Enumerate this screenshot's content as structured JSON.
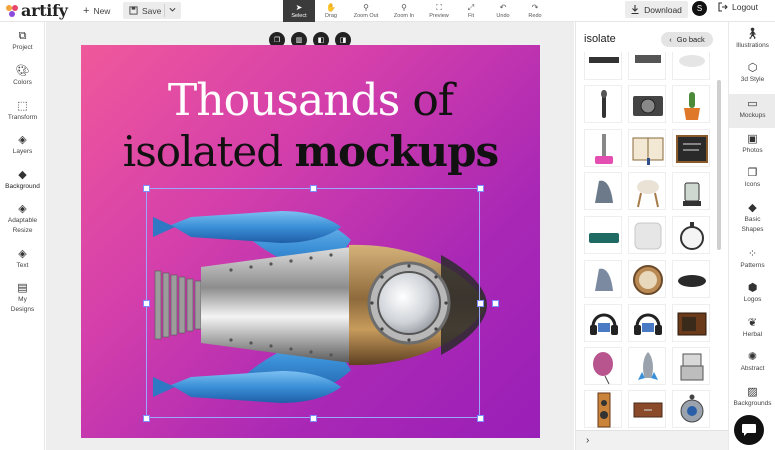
{
  "brand": {
    "name": "artify"
  },
  "toolbar": {
    "new_label": "New",
    "save_label": "Save",
    "tools": [
      {
        "label": "Select",
        "icon": "cursor-icon",
        "active": true
      },
      {
        "label": "Drag",
        "icon": "hand-icon"
      },
      {
        "label": "Zoom Out",
        "icon": "zoom-out-icon"
      },
      {
        "label": "Zoom In",
        "icon": "zoom-in-icon"
      },
      {
        "label": "Preview",
        "icon": "preview-icon"
      },
      {
        "label": "Fit",
        "icon": "fit-icon"
      },
      {
        "label": "Undo",
        "icon": "undo-icon"
      },
      {
        "label": "Redo",
        "icon": "redo-icon"
      }
    ],
    "download_label": "Download",
    "avatar_initial": "S",
    "logout_label": "Logout"
  },
  "left_sidebar": {
    "items": [
      {
        "label": "Project",
        "icon": "project-icon"
      },
      {
        "label": "Colors",
        "icon": "palette-icon"
      },
      {
        "label": "Transform",
        "icon": "transform-icon"
      },
      {
        "label": "Layers",
        "icon": "layers-icon"
      },
      {
        "label": "Background",
        "icon": "paint-bucket-icon",
        "active": true
      },
      {
        "label_line1": "Adaptable",
        "label_line2": "Resize",
        "icon": "stack-icon"
      },
      {
        "label": "Text",
        "icon": "text-icon"
      },
      {
        "label_line1": "My",
        "label_line2": "Designs",
        "icon": "folder-icon"
      }
    ]
  },
  "context_menu": {
    "items": [
      {
        "label": "Clone",
        "icon": "clone-icon"
      },
      {
        "label": "Del",
        "icon": "trash-icon"
      },
      {
        "label": "Fwd",
        "icon": "bring-forward-icon"
      },
      {
        "label": "Bwd",
        "icon": "send-backward-icon"
      }
    ]
  },
  "canvas": {
    "line1_a": "Thousands",
    "line1_b": "of",
    "line2_a": "isolated",
    "line2_b": "mockups",
    "gradient_start": "#f0589b",
    "gradient_end": "#9a1fb8"
  },
  "right_panel": {
    "search_term": "isolate",
    "go_back_label": "Go back",
    "thumbnails": [
      {
        "icon": "device-edge-icon"
      },
      {
        "icon": "camera-edge-icon"
      },
      {
        "icon": "cloud-icon"
      },
      {
        "icon": "microphone-icon"
      },
      {
        "icon": "camera-icon"
      },
      {
        "icon": "cactus-icon"
      },
      {
        "icon": "pink-stand-icon"
      },
      {
        "icon": "open-book-icon"
      },
      {
        "icon": "chalkboard-icon"
      },
      {
        "icon": "iron-icon"
      },
      {
        "icon": "chair-icon"
      },
      {
        "icon": "lantern-icon"
      },
      {
        "icon": "sofa-icon"
      },
      {
        "icon": "pillow-icon"
      },
      {
        "icon": "stopwatch-icon"
      },
      {
        "icon": "iron-icon"
      },
      {
        "icon": "clock-icon"
      },
      {
        "icon": "tray-icon"
      },
      {
        "icon": "headphones-icon"
      },
      {
        "icon": "headphones-icon"
      },
      {
        "icon": "radio-icon"
      },
      {
        "icon": "balloon-icon"
      },
      {
        "icon": "rocket-icon"
      },
      {
        "icon": "robot-icon"
      },
      {
        "icon": "speaker-icon"
      },
      {
        "icon": "drawer-icon"
      },
      {
        "icon": "robot-ball-icon"
      },
      {
        "icon": "partial-icon"
      },
      {
        "icon": "partial-icon"
      },
      {
        "icon": "partial-icon"
      }
    ]
  },
  "right_sidebar": {
    "items": [
      {
        "label": "Illustrations",
        "icon": "figure-icon"
      },
      {
        "label": "3d Style",
        "icon": "cube-icon"
      },
      {
        "label": "Mockups",
        "icon": "monitor-icon",
        "active": true
      },
      {
        "label": "Photos",
        "icon": "photo-icon"
      },
      {
        "label": "Icons",
        "icon": "copy-icon"
      },
      {
        "label_line1": "Basic",
        "label_line2": "Shapes",
        "icon": "shapes-icon"
      },
      {
        "label": "Patterns",
        "icon": "pattern-icon"
      },
      {
        "label": "Logos",
        "icon": "hexagon-icon"
      },
      {
        "label": "Herbal",
        "icon": "leaf-icon"
      },
      {
        "label": "Abstract",
        "icon": "abstract-icon"
      },
      {
        "label": "Backgrounds",
        "icon": "background-icon"
      }
    ]
  },
  "colors": {
    "accent_dark": "#222222",
    "selection": "#7d8cff"
  }
}
